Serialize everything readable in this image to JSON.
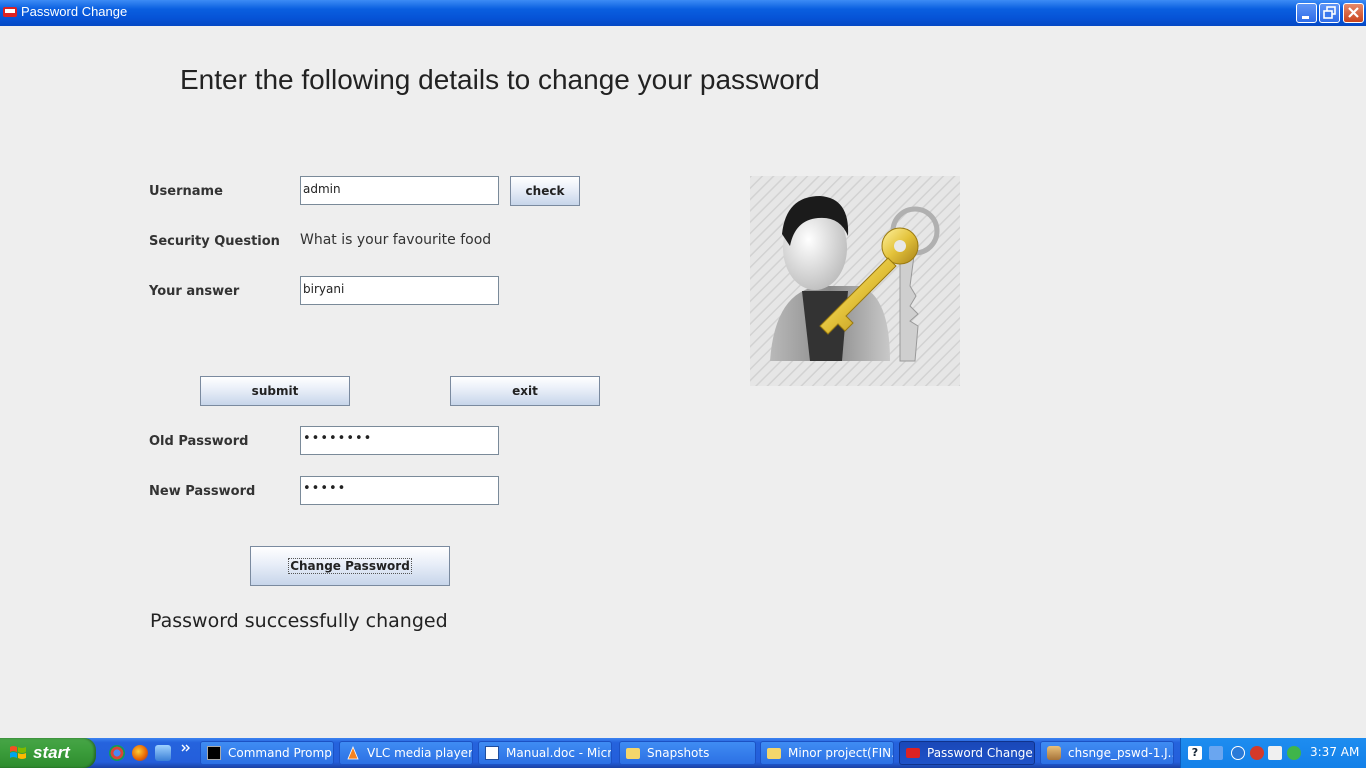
{
  "window": {
    "title": "Password Change",
    "controls": {
      "minimize": "minimize-icon",
      "maximize": "restore-icon",
      "close": "close-icon"
    }
  },
  "form": {
    "heading": "Enter the following details to change your password",
    "username_label": "Username",
    "username_value": "admin",
    "check_label": "check",
    "question_label": "Security Question",
    "question_text": "What is your favourite food",
    "answer_label": "Your answer",
    "answer_value": "biryani",
    "submit_label": "submit",
    "exit_label": "exit",
    "old_password_label": "Old Password",
    "old_password_mask": "••••••••",
    "new_password_label": "New Password",
    "new_password_mask": "•••••",
    "change_label": "Change Password",
    "status": "Password successfully changed"
  },
  "illustration": {
    "icon": "user-key-icon"
  },
  "taskbar": {
    "start_label": "start",
    "quick_launch": [
      "chrome-icon",
      "firefox-icon",
      "ie-icon"
    ],
    "tasks": [
      {
        "label": "Command Promp...",
        "icon": "cmd-icon"
      },
      {
        "label": "VLC media player",
        "icon": "vlc-icon"
      },
      {
        "label": "Manual.doc - Micr...",
        "icon": "word-icon"
      },
      {
        "label": "Snapshots",
        "icon": "folder-icon"
      },
      {
        "label": "Minor project(FIN...",
        "icon": "folder-icon"
      },
      {
        "label": "Password Change",
        "icon": "java-icon",
        "active": true
      },
      {
        "label": "chsnge_pswd-1.J...",
        "icon": "paint-icon"
      }
    ],
    "clock": "3:37 AM"
  },
  "colors": {
    "titlebar": "#0a5fe0",
    "taskbar": "#245edb",
    "start": "#3c9e3c",
    "background": "#eeeeee"
  }
}
